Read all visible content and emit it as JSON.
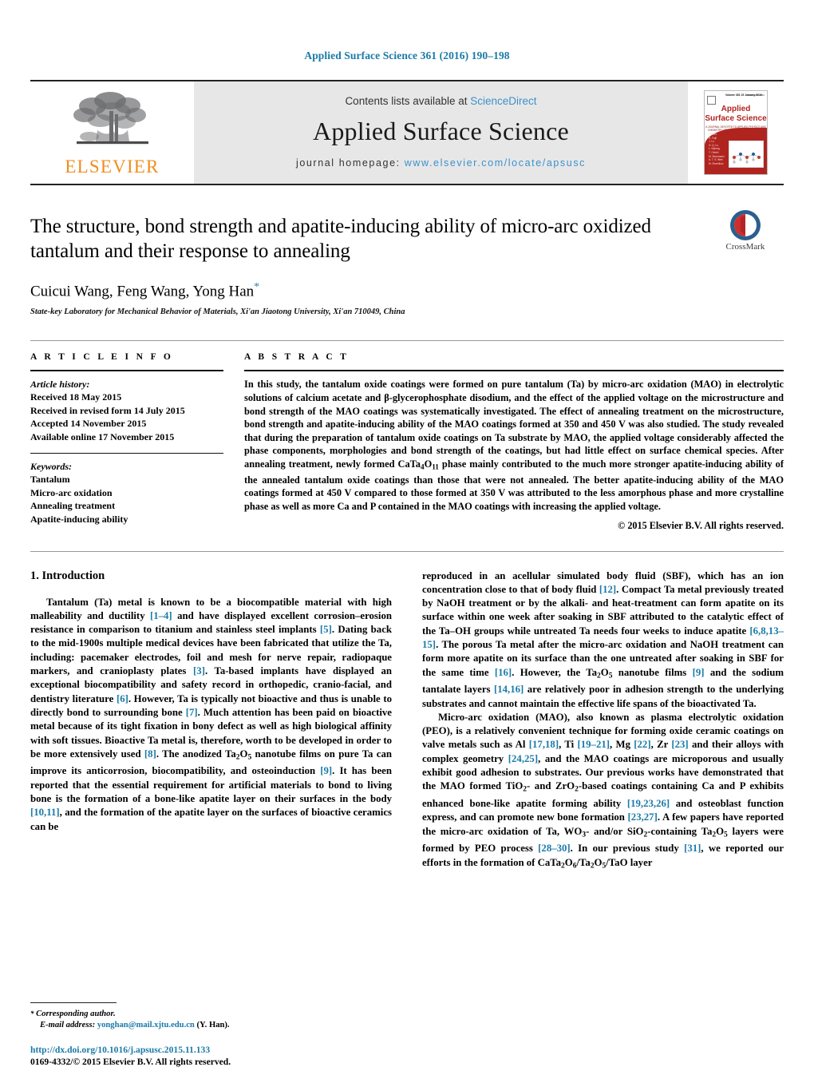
{
  "running_head": "Applied Surface Science 361 (2016) 190–198",
  "masthead": {
    "contents_prefix": "Contents lists available at ",
    "contents_link": "ScienceDirect",
    "journal_title": "Applied Surface Science",
    "homepage_prefix": "journal homepage: ",
    "homepage_url": "www.elsevier.com/locate/apsusc",
    "publisher_logo_word": "ELSEVIER",
    "publisher_logo_icon": "elsevier-tree-icon",
    "cover": {
      "issn": "ISSN 0169-4332",
      "volume": "Volume 361  15 January 2016",
      "issue_label": "ISSN 0169-4332",
      "title_line1": "Applied",
      "title_line2": "Surface Science",
      "subtitle": "A JOURNAL DEVOTED TO APPLIED PHYSICS AND CHEMISTRY OF SURFACES AND INTERFACES",
      "red_panel_text": "Editors\nH. Fujii\nJ. Lu\nG. Q. Lu\nL. Nyborg\nT. Onishi\nM. Stutzmann\nA. T. S. Wee\nM. Zharnikov"
    }
  },
  "article": {
    "title": "The structure, bond strength and apatite-inducing ability of micro-arc oxidized tantalum and their response to annealing",
    "authors": "Cuicui Wang, Feng Wang, Yong Han",
    "corresponding_marker": "*",
    "affiliation": "State-key Laboratory for Mechanical Behavior of Materials, Xi'an Jiaotong University, Xi'an 710049, China",
    "crossmark_label": "CrossMark",
    "crossmark_icon": "crossmark-icon"
  },
  "article_info": {
    "heading": "A R T I C L E   I N F O",
    "history_heading": "Article history:",
    "history": [
      "Received 18 May 2015",
      "Received in revised form 14 July 2015",
      "Accepted 14 November 2015",
      "Available online 17 November 2015"
    ],
    "keywords_heading": "Keywords:",
    "keywords": [
      "Tantalum",
      "Micro-arc oxidation",
      "Annealing treatment",
      "Apatite-inducing ability"
    ]
  },
  "abstract": {
    "heading": "A B S T R A C T",
    "text": "In this study, the tantalum oxide coatings were formed on pure tantalum (Ta) by micro-arc oxidation (MAO) in electrolytic solutions of calcium acetate and β-glycerophosphate disodium, and the effect of the applied voltage on the microstructure and bond strength of the MAO coatings was systematically investigated. The effect of annealing treatment on the microstructure, bond strength and apatite-inducing ability of the MAO coatings formed at 350 and 450 V was also studied. The study revealed that during the preparation of tantalum oxide coatings on Ta substrate by MAO, the applied voltage considerably affected the phase components, morphologies and bond strength of the coatings, but had little effect on surface chemical species. After annealing treatment, newly formed CaTa4O11 phase mainly contributed to the much more stronger apatite-inducing ability of the annealed tantalum oxide coatings than those that were not annealed. The better apatite-inducing ability of the MAO coatings formed at 450 V compared to those formed at 350 V was attributed to the less amorphous phase and more crystalline phase as well as more Ca and P contained in the MAO coatings with increasing the applied voltage.",
    "copyright": "© 2015 Elsevier B.V. All rights reserved."
  },
  "body": {
    "section_heading": "1.  Introduction",
    "left_paragraph": "Tantalum (Ta) metal is known to be a biocompatible material with high malleability and ductility [1–4] and have displayed excellent corrosion–erosion resistance in comparison to titanium and stainless steel implants [5]. Dating back to the mid-1900s multiple medical devices have been fabricated that utilize the Ta, including: pacemaker electrodes, foil and mesh for nerve repair, radiopaque markers, and cranioplasty plates [3]. Ta-based implants have displayed an exceptional biocompatibility and safety record in orthopedic, cranio-facial, and dentistry literature [6]. However, Ta is typically not bioactive and thus is unable to directly bond to surrounding bone [7]. Much attention has been paid on bioactive metal because of its tight fixation in bony defect as well as high biological affinity with soft tissues. Bioactive Ta metal is, therefore, worth to be developed in order to be more extensively used [8]. The anodized Ta2O5 nanotube films on pure Ta can improve its anticorrosion, biocompatibility, and osteoinduction [9]. It has been reported that the essential requirement for artificial materials to bond to living bone is the formation of a bone-like apatite layer on their surfaces in the body [10,11], and the formation of the apatite layer on the surfaces of bioactive ceramics can be",
    "right_paragraph_1": "reproduced in an acellular simulated body fluid (SBF), which has an ion concentration close to that of body fluid [12]. Compact Ta metal previously treated by NaOH treatment or by the alkali- and heat-treatment can form apatite on its surface within one week after soaking in SBF attributed to the catalytic effect of the Ta–OH groups while untreated Ta needs four weeks to induce apatite [6,8,13–15]. The porous Ta metal after the micro-arc oxidation and NaOH treatment can form more apatite on its surface than the one untreated after soaking in SBF for the same time [16]. However, the Ta2O5 nanotube films [9] and the sodium tantalate layers [14,16] are relatively poor in adhesion strength to the underlying substrates and cannot maintain the effective life spans of the bioactivated Ta.",
    "right_paragraph_2": "Micro-arc oxidation (MAO), also known as plasma electrolytic oxidation (PEO), is a relatively convenient technique for forming oxide ceramic coatings on valve metals such as Al [17,18], Ti [19–21], Mg [22], Zr [23] and their alloys with complex geometry [24,25], and the MAO coatings are microporous and usually exhibit good adhesion to substrates. Our previous works have demonstrated that the MAO formed TiO2- and ZrO2-based coatings containing Ca and P exhibits enhanced bone-like apatite forming ability [19,23,26] and osteoblast function express, and can promote new bone formation [23,27]. A few papers have reported the micro-arc oxidation of Ta, WO3- and/or SiO2-containing Ta2O5 layers were formed by PEO process [28–30]. In our previous study [31], we reported our efforts in the formation of CaTa2O6/Ta2O5/TaO layer"
  },
  "footnote": {
    "corresponding_marker": "*",
    "corresponding_label": "Corresponding author.",
    "email_label": "E-mail address:",
    "email": "yonghan@mail.xjtu.edu.cn",
    "email_suffix": "(Y. Han)."
  },
  "footer": {
    "doi": "http://dx.doi.org/10.1016/j.apsusc.2015.11.133",
    "issn_line": "0169-4332/© 2015 Elsevier B.V. All rights reserved."
  },
  "colors": {
    "link": "#1a7aa8",
    "elsevier_orange": "#F08C1E",
    "cover_red": "#b0241f",
    "sciencedirect_blue": "#3d91c8"
  }
}
